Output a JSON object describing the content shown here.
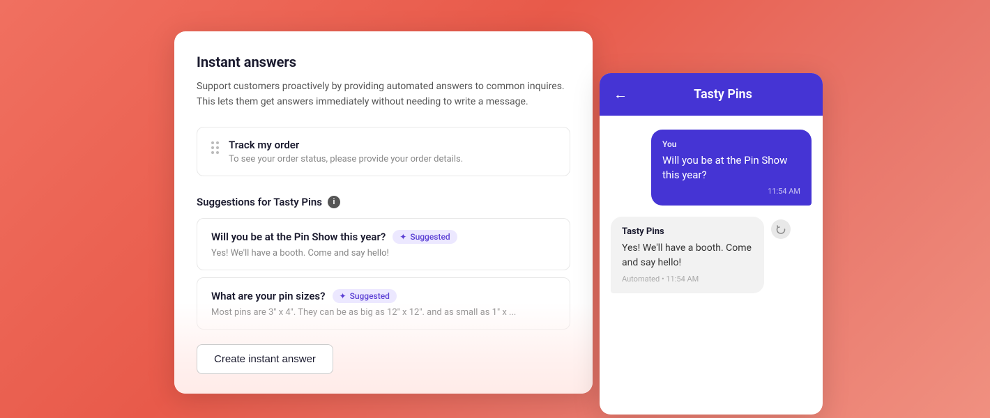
{
  "page": {
    "background": "coral-gradient"
  },
  "instant_answers_panel": {
    "title": "Instant answers",
    "description": "Support customers proactively by providing automated answers to common inquires. This lets them get answers immediately without needing to write a message.",
    "track_order": {
      "title": "Track my order",
      "subtitle": "To see your order status, please provide your order details."
    },
    "suggestions_header": "Suggestions for Tasty Pins",
    "suggestions": [
      {
        "title": "Will you be at the Pin Show this year?",
        "badge": "Suggested",
        "text": "Yes! We'll have a booth. Come and say hello!"
      },
      {
        "title": "What are your pin sizes?",
        "badge": "Suggested",
        "text": "Most pins are 3\" x 4\". They can be as big as 12\" x 12\". and as small as 1\" x ..."
      }
    ],
    "create_button": "Create instant answer"
  },
  "chat_panel": {
    "title": "Tasty Pins",
    "back_label": "←",
    "user_message": {
      "label": "You",
      "text": "Will you be at the Pin Show this year?",
      "time": "11:54 AM"
    },
    "bot_message": {
      "name": "Tasty Pins",
      "text": "Yes! We'll have a booth. Come and say hello!",
      "meta": "Automated • 11:54 AM"
    }
  }
}
